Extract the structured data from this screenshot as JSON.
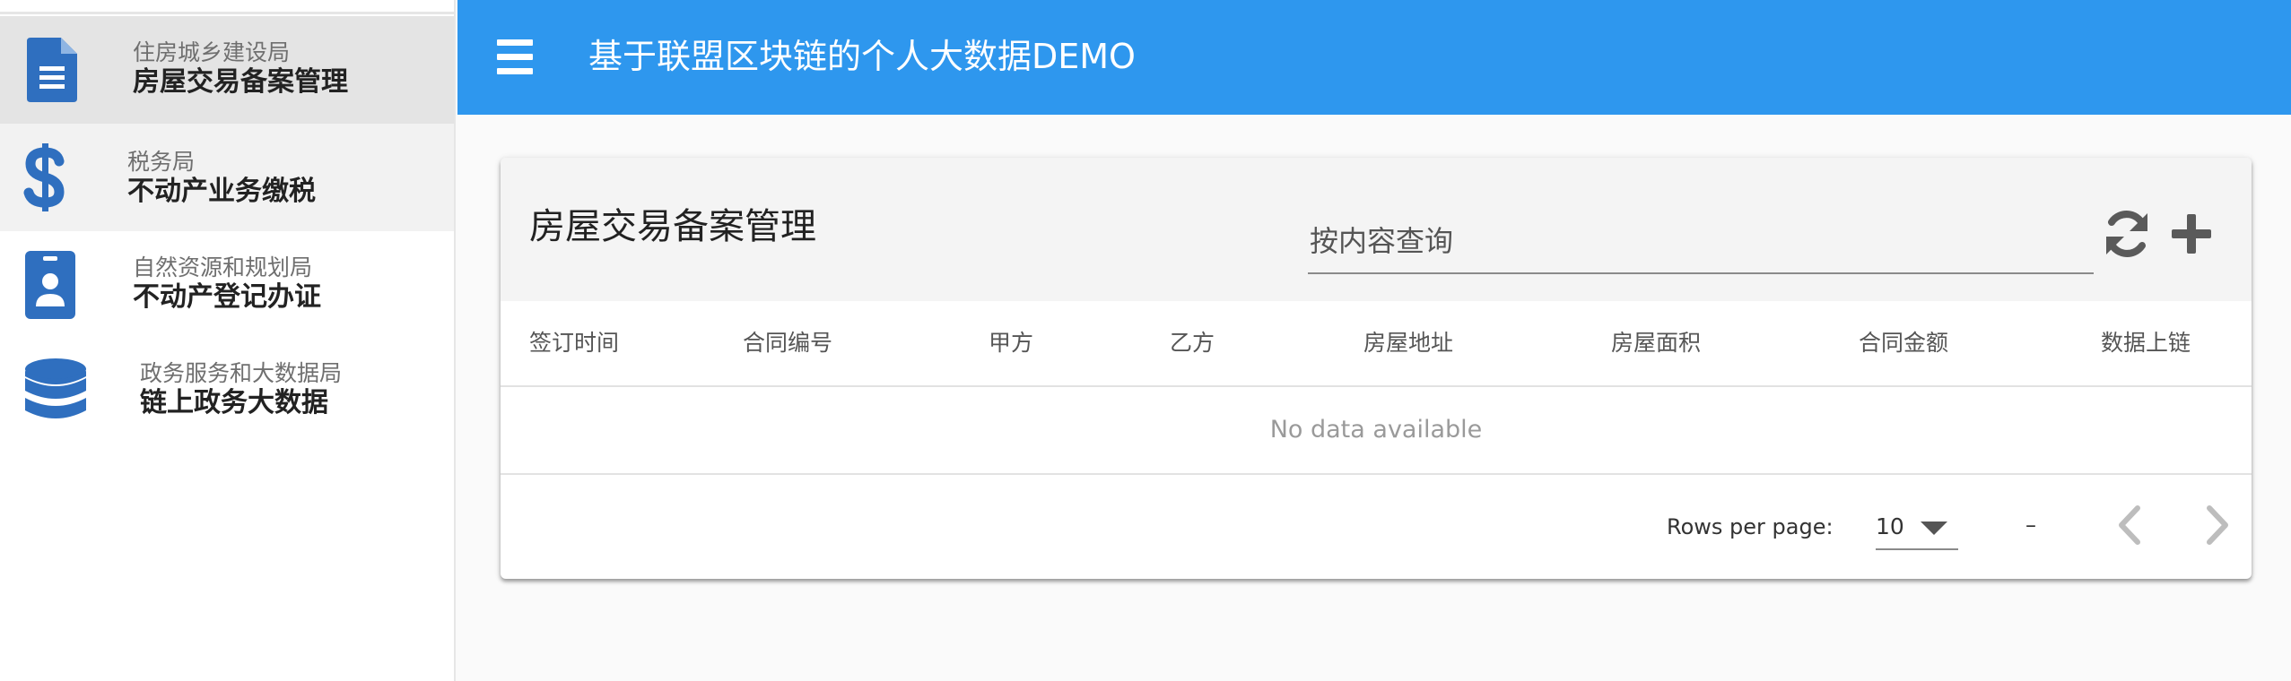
{
  "sidebar": {
    "items": [
      {
        "sub": "住房城乡建设局",
        "main": "房屋交易备案管理",
        "icon": "document-icon"
      },
      {
        "sub": "税务局",
        "main": "不动产业务缴税",
        "icon": "dollar-icon"
      },
      {
        "sub": "自然资源和规划局",
        "main": "不动产登记办证",
        "icon": "id-badge-icon"
      },
      {
        "sub": "政务服务和大数据局",
        "main": "链上政务大数据",
        "icon": "database-icon"
      }
    ]
  },
  "appbar": {
    "title": "基于联盟区块链的个人大数据DEMO",
    "color": "#2e97ee"
  },
  "card": {
    "title": "房屋交易备案管理",
    "search_placeholder": "按内容查询",
    "columns": [
      "签订时间",
      "合同编号",
      "甲方",
      "乙方",
      "房屋地址",
      "房屋面积",
      "合同金额",
      "数据上链"
    ],
    "empty_text": "No data available",
    "footer": {
      "rows_per_page_label": "Rows per page:",
      "rows_per_page_value": "10",
      "range_text": "–"
    }
  },
  "colors": {
    "accent": "#2e97ee",
    "icon": "#2f6fbf"
  }
}
